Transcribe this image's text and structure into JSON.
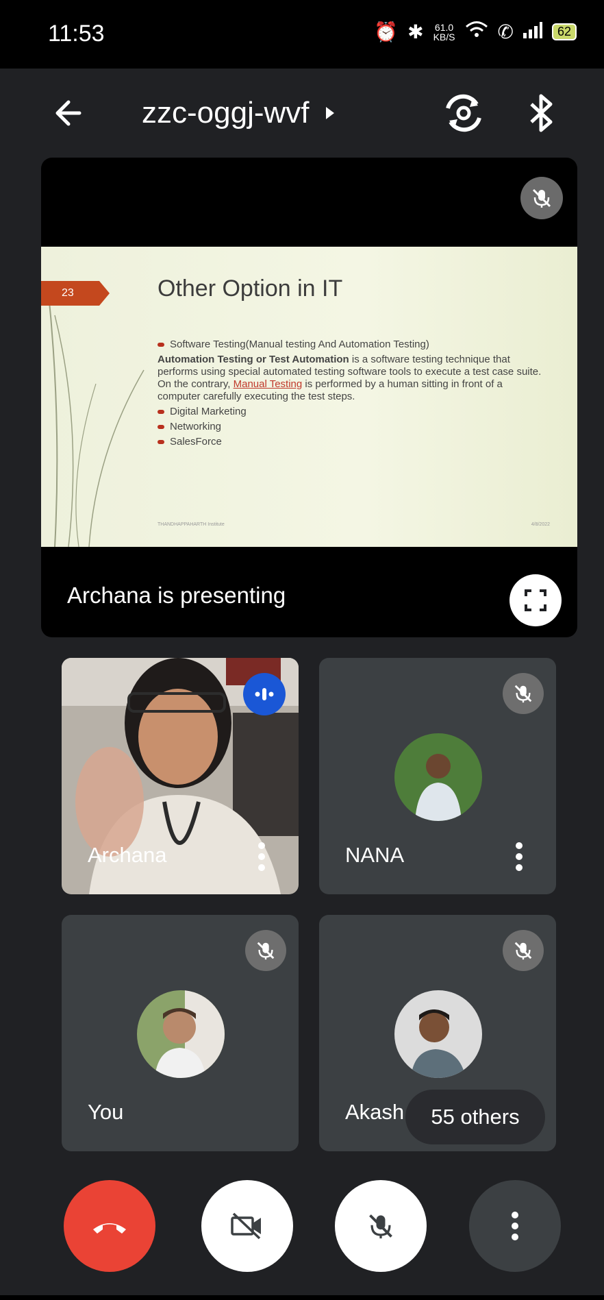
{
  "status_bar": {
    "time": "11:53",
    "speed_value": "61.0",
    "speed_unit": "KB/S",
    "battery": "62",
    "icons": [
      "alarm-icon",
      "bluetooth-vibrate-icon",
      "wifi-icon",
      "volte-call-icon",
      "signal-icon",
      "battery-icon"
    ]
  },
  "top_bar": {
    "meeting_code": "zzc-oggj-wvf",
    "back_icon": "arrow-left-icon",
    "switch_camera_icon": "switch-camera-icon",
    "audio_icon": "bluetooth-icon"
  },
  "presentation": {
    "slide_number": "23",
    "slide_title": "Other Option in IT",
    "bullet_1": "Software Testing(Manual testing And Automation Testing)",
    "para_bold": "Automation Testing or Test Automation",
    "para_text_1": " is a software testing technique that performs using special automated testing software tools to execute a test case suite. On the contrary, ",
    "para_link": "Manual Testing",
    "para_text_2": " is performed by a human sitting in front of a computer carefully executing the test steps.",
    "bullet_2": "Digital Marketing",
    "bullet_3": "Networking",
    "bullet_4": "SalesForce",
    "footer_left": "THANDHAPPAHARTH Institute",
    "footer_right": "4/8/2022",
    "presenting_text": "Archana is presenting"
  },
  "participants": [
    {
      "name": "Archana",
      "speaking": true
    },
    {
      "name": "NANA",
      "muted": true
    },
    {
      "name": "You",
      "muted": true
    },
    {
      "name": "Akash",
      "muted": true
    }
  ],
  "others_label": "55 others",
  "controls": {
    "end_call": "end-call-icon",
    "camera": "camera-off-icon",
    "mic": "mic-off-icon",
    "more": "more-vert-icon"
  },
  "colors": {
    "background": "#202124",
    "end_call": "#ea4335",
    "tile": "#3c4043",
    "speaking_badge": "#1a57d6",
    "slide_accent": "#c4481e"
  }
}
